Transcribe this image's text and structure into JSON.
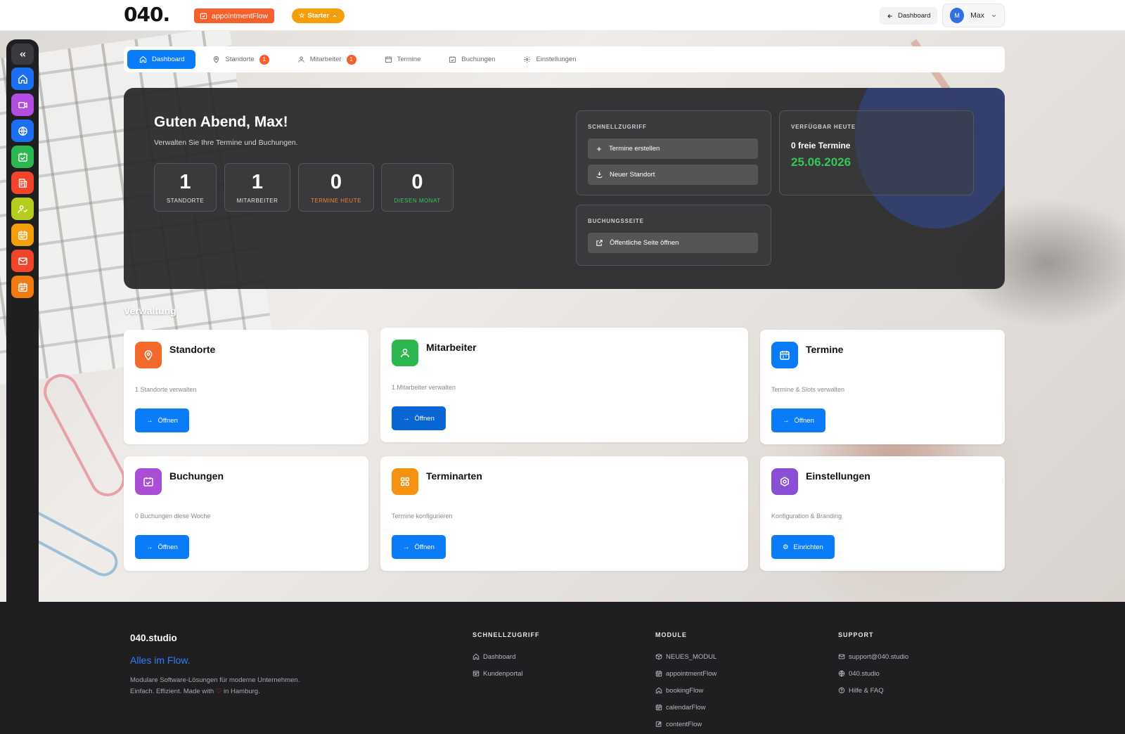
{
  "topbar": {
    "logo": "040.",
    "app_name": "appointmentFlow",
    "plan": "Starter",
    "dashboard_button": "Dashboard",
    "user_initial": "M",
    "user_name": "Max"
  },
  "tabs": [
    {
      "label": "Dashboard",
      "icon": "home-icon",
      "active": true
    },
    {
      "label": "Standorte",
      "icon": "map-pin-icon",
      "badge": "1"
    },
    {
      "label": "Mitarbeiter",
      "icon": "user-icon",
      "badge": "1"
    },
    {
      "label": "Termine",
      "icon": "calendar-icon"
    },
    {
      "label": "Buchungen",
      "icon": "calendar-check-icon"
    },
    {
      "label": "Einstellungen",
      "icon": "gear-icon"
    }
  ],
  "dock": {
    "apps": [
      {
        "icon": "home-icon",
        "color": "#1c6ff0"
      },
      {
        "icon": "video-icon",
        "color": "#b14de0"
      },
      {
        "icon": "globe-icon",
        "color": "#1c6ff0"
      },
      {
        "icon": "calendar-check-icon",
        "color": "#2cb84f"
      },
      {
        "icon": "document-icon",
        "color": "#f0452a"
      },
      {
        "icon": "user-check-icon",
        "color": "#b6cc1e"
      },
      {
        "icon": "calendar-grid-icon",
        "color": "#f59e0b"
      },
      {
        "icon": "mail-icon",
        "color": "#f0452a"
      },
      {
        "icon": "calendar-icon",
        "color": "#f27a14"
      }
    ],
    "bottom": [
      {
        "icon": "help-icon",
        "color": "#8b3fe0"
      },
      {
        "icon": "plus-icon",
        "color": "#2cb84f"
      },
      {
        "icon": "gear-icon",
        "color": "#1c6ff0"
      }
    ]
  },
  "hero": {
    "greeting": "Guten Abend, Max!",
    "subtitle": "Verwalten Sie Ihre Termine und Buchungen.",
    "stats": [
      {
        "value": "1",
        "label": "STANDORTE",
        "color": "#e5e5e7"
      },
      {
        "value": "1",
        "label": "MITARBEITER",
        "color": "#e5e5e7"
      },
      {
        "value": "0",
        "label": "TERMINE HEUTE",
        "color": "#f0823a"
      },
      {
        "value": "0",
        "label": "DIESEN MONAT",
        "color": "#34c759"
      }
    ],
    "quick": {
      "title": "SCHNELLZUGRIFF",
      "create_label": "Termine erstellen",
      "location_label": "Neuer Standort"
    },
    "booking": {
      "title": "BUCHUNGSSEITE",
      "open_public_label": "Öffentliche Seite öffnen"
    },
    "available": {
      "title": "VERFÜGBAR HEUTE",
      "free": "0 freie Termine",
      "date": "25.06.2026"
    }
  },
  "section_title": "Verwaltung",
  "cards": [
    {
      "title": "Standorte",
      "desc": "1 Standorte verwalten",
      "button": "Öffnen",
      "icon": "map-pin-icon",
      "color": "#f26a2b"
    },
    {
      "title": "Mitarbeiter",
      "desc": "1 Mitarbeiter verwalten",
      "button": "Öffnen",
      "icon": "user-icon",
      "color": "#2cb84f"
    },
    {
      "title": "Termine",
      "desc": "Termine & Slots verwalten",
      "button": "Öffnen",
      "icon": "calendar-icon",
      "color": "#0a7cf7"
    },
    {
      "title": "Buchungen",
      "desc": "0 Buchungen diese Woche",
      "button": "Öffnen",
      "icon": "calendar-check-icon",
      "color": "#a94fd6"
    },
    {
      "title": "Terminarten",
      "desc": "Termine konfigurieren",
      "button": "Öffnen",
      "icon": "grid-icon",
      "color": "#f5920f"
    },
    {
      "title": "Einstellungen",
      "desc": "Konfiguration & Branding",
      "button": "Einrichten",
      "icon": "gear-icon",
      "color": "#8b4fd6"
    }
  ],
  "footer": {
    "brand": "040.studio",
    "tagline": "Alles im Flow.",
    "desc_line1": "Modulare Software-Lösungen für moderne Unternehmen.",
    "desc_line2_a": "Einfach. Effizient. Made with",
    "desc_line2_b": "in Hamburg.",
    "columns": [
      {
        "title": "SCHNELLZUGRIFF",
        "links": [
          {
            "label": "Dashboard",
            "icon": "home-icon"
          },
          {
            "label": "Kundenportal",
            "icon": "portal-icon"
          }
        ]
      },
      {
        "title": "MODULE",
        "links": [
          {
            "label": "NEUES_MODUL",
            "icon": "box-icon"
          },
          {
            "label": "appointmentFlow",
            "icon": "calendar-icon"
          },
          {
            "label": "bookingFlow",
            "icon": "home-icon"
          },
          {
            "label": "calendarFlow",
            "icon": "calendar-icon"
          },
          {
            "label": "contentFlow",
            "icon": "edit-icon"
          }
        ]
      },
      {
        "title": "SUPPORT",
        "links": [
          {
            "label": "support@040.studio",
            "icon": "mail-icon"
          },
          {
            "label": "040.studio",
            "icon": "globe-icon"
          },
          {
            "label": "Hilfe & FAQ",
            "icon": "help-icon"
          }
        ]
      }
    ]
  }
}
